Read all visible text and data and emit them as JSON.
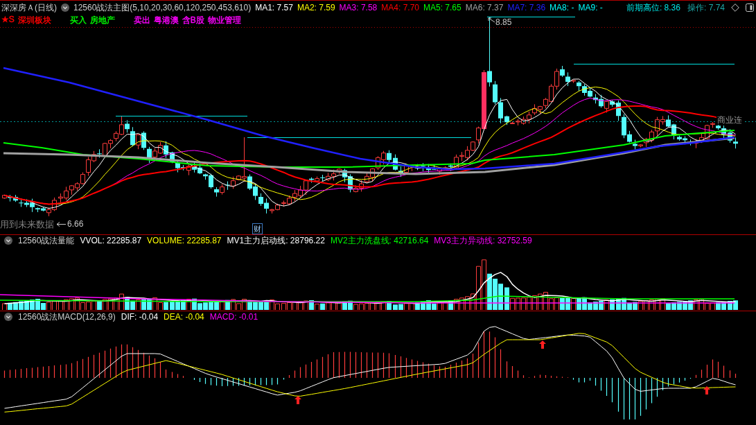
{
  "main_panel": {
    "stock_title": "深深房Ａ(日线)",
    "indicator": "12560战法主图(5,10,20,30,60,120,250,453,610)",
    "readings": [
      {
        "text": "MA1: 7.57",
        "color": "#ffffff"
      },
      {
        "text": "MA2: 7.59",
        "color": "#ffff00"
      },
      {
        "text": "MA3: 7.58",
        "color": "#ff00ff"
      },
      {
        "text": "MA4: 7.70",
        "color": "#ff0000"
      },
      {
        "text": "MA5: 7.65",
        "color": "#00ff00"
      },
      {
        "text": "MA6: 7.37",
        "color": "#a0a0a0"
      },
      {
        "text": "MA7: 7.36",
        "color": "#2020ff"
      },
      {
        "text": "MA8: -",
        "color": "#00ffff"
      },
      {
        "text": "MA9: -",
        "color": "#00ffff"
      }
    ],
    "prior_high": "前期高位: 8.36",
    "operation": "操作: 7.74",
    "tag_groups": [
      [
        {
          "text": "★S",
          "color": "#ff0000"
        },
        {
          "text": "深圳板块",
          "color": "#ff0000"
        }
      ],
      [
        {
          "text": "买入",
          "color": "#00ff00"
        },
        {
          "text": "房地产",
          "color": "#00ff00"
        }
      ],
      [
        {
          "text": "卖出",
          "color": "#ff00ff"
        },
        {
          "text": "粤港澳",
          "color": "#ff00ff"
        },
        {
          "text": "含B股",
          "color": "#ff00ff"
        },
        {
          "text": "物业管理",
          "color": "#ff00ff"
        }
      ]
    ],
    "high_label": "8.85",
    "low_label": "6.66",
    "warning": "用到未来数据",
    "event_marker": "财",
    "right_edge_label": "商业连"
  },
  "volume_panel": {
    "indicator": "12560战法量能",
    "readings": [
      {
        "text": "VVOL: 22285.87",
        "color": "#ffffff"
      },
      {
        "text": "VOLUME: 22285.87",
        "color": "#ffff00"
      },
      {
        "text": "MV1主力启动线: 28796.22",
        "color": "#ffffff"
      },
      {
        "text": "MV2主力洗盘线: 42716.64",
        "color": "#00ff00"
      },
      {
        "text": "MV3主力异动线: 32752.59",
        "color": "#ff00ff"
      }
    ]
  },
  "macd_panel": {
    "indicator": "12560战法MACD(12,26,9)",
    "readings": [
      {
        "text": "DIF: -0.04",
        "color": "#ffffff"
      },
      {
        "text": "DEA: -0.04",
        "color": "#ffff00"
      },
      {
        "text": "MACD: -0.01",
        "color": "#ff00ff"
      }
    ]
  }
}
